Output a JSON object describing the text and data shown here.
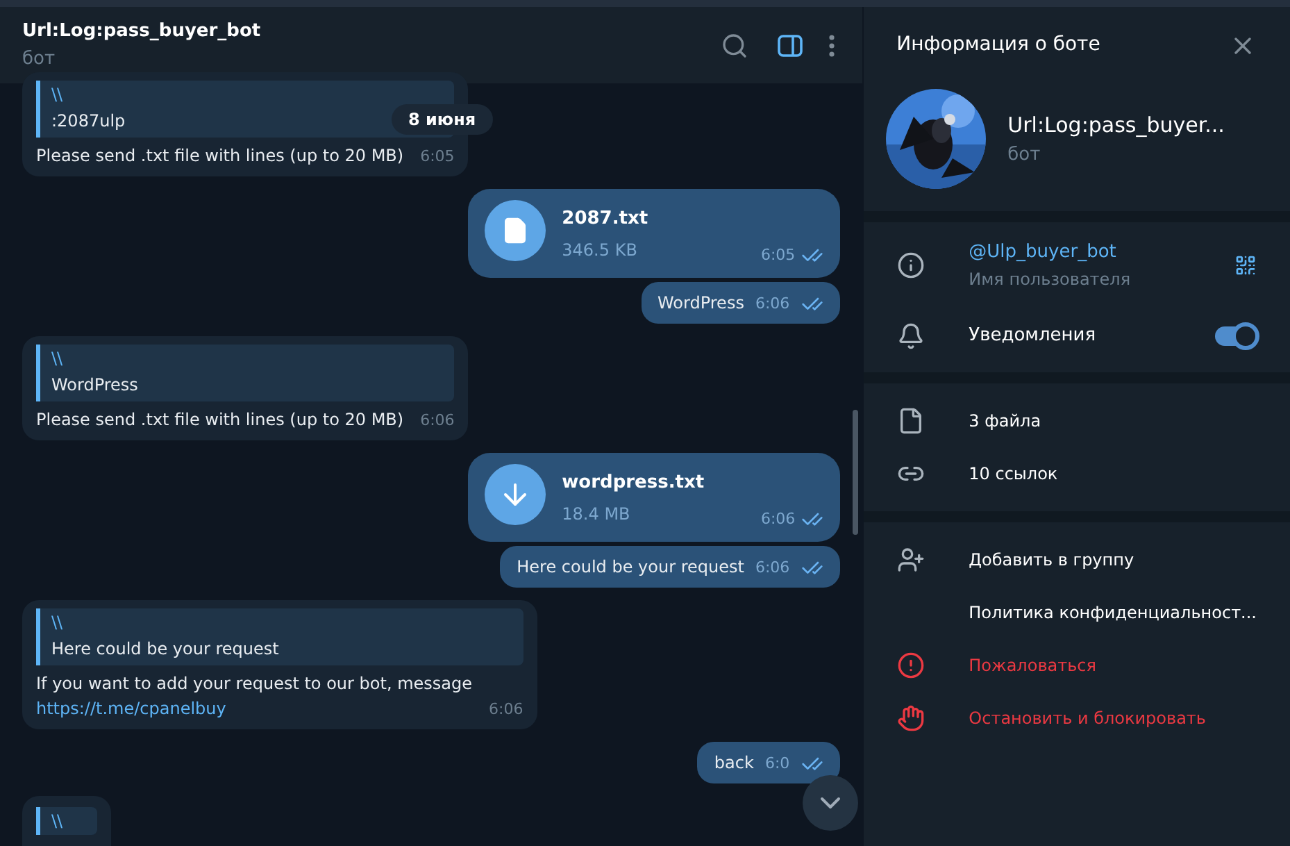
{
  "chat": {
    "title": "Url:Log:pass_buyer_bot",
    "subtitle": "бот",
    "side_panel_open": true
  },
  "date_pill": "8 июня",
  "messages": [
    {
      "kind": "reply",
      "quote_author": "\\\\",
      "quote_text": ":2087ulp",
      "text": "Please send .txt file with lines (up to 20 MB)",
      "time": "6:05"
    },
    {
      "kind": "file",
      "name": "2087.txt",
      "size": "346.5 KB",
      "downloaded": true,
      "time": "6:05",
      "read": true
    },
    {
      "kind": "text",
      "text": "WordPress",
      "time": "6:06",
      "read": true
    },
    {
      "kind": "reply",
      "quote_author": "\\\\",
      "quote_text": "WordPress",
      "text": "Please send .txt file with lines (up to 20 MB)",
      "time": "6:06"
    },
    {
      "kind": "file",
      "name": "wordpress.txt",
      "size": "18.4 MB",
      "downloaded": false,
      "time": "6:06",
      "read": true
    },
    {
      "kind": "text",
      "text": "Here could be your request",
      "time": "6:06",
      "read": true
    },
    {
      "kind": "reply",
      "quote_author": "\\\\",
      "quote_text": "Here could be your request",
      "text": "If you want to add your request to our bot, message",
      "link": "https://t.me/cpanelbuy",
      "time": "6:06"
    },
    {
      "kind": "text",
      "text": "back",
      "time": "6:0",
      "read": true
    },
    {
      "kind": "partial",
      "quote_author": "\\\\"
    }
  ],
  "info": {
    "title": "Информация о боте",
    "name": "Url:Log:pass_buyer...",
    "subtitle": "бот",
    "username": "@Ulp_buyer_bot",
    "username_label": "Имя пользователя",
    "notifications": {
      "label": "Уведомления",
      "on": true
    },
    "media": [
      {
        "kind": "file",
        "label": "3 файла"
      },
      {
        "kind": "link",
        "label": "10 ссылок"
      }
    ],
    "actions": [
      {
        "kind": "add",
        "label": "Добавить в группу",
        "danger": false
      },
      {
        "kind": "none",
        "label": "Политика конфиденциальност...",
        "danger": false
      },
      {
        "kind": "report",
        "label": "Пожаловаться",
        "danger": true
      },
      {
        "kind": "block",
        "label": "Остановить и блокировать",
        "danger": true
      }
    ]
  }
}
